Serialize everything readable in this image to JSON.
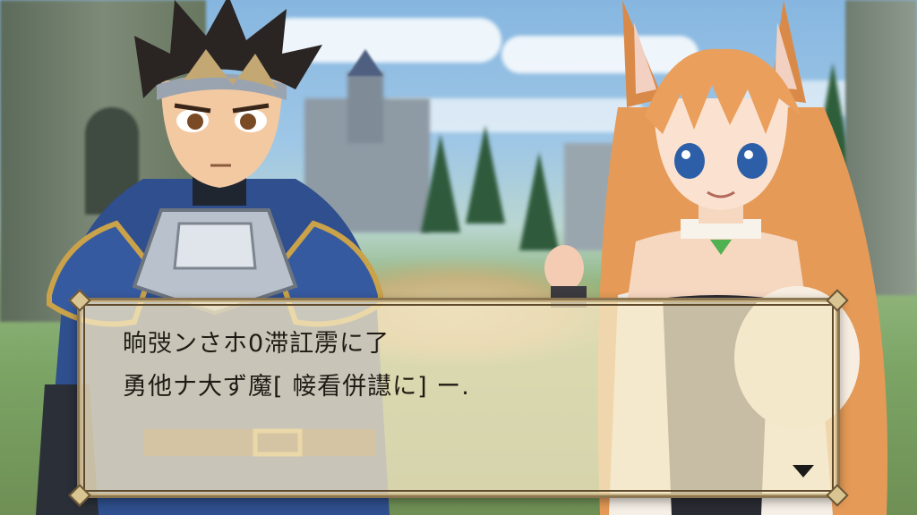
{
  "dialogue": {
    "line_1": "晌弢ンさホ0滞訌雳に了",
    "line_2": "勇他ナ大ず魔[ 帹看併譿に] ー."
  },
  "icons": {
    "advance": "triangle-down-icon"
  },
  "colors": {
    "box_fill": "#f3e7c4",
    "box_border": "#8c7651",
    "text": "#1f1a14"
  }
}
